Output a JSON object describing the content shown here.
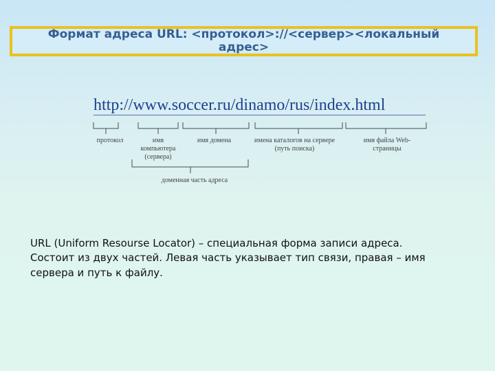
{
  "slide": {
    "title": "Формат адреса URL: <протокол>://<сервер><локальный адрес>",
    "diagram": {
      "url": "http://www.soccer.ru/dinamo/rus/index.html",
      "labels": {
        "protocol": "протокол",
        "computer_name": "имя компьютера (сервера)",
        "domain_name": "имя домена",
        "directory_names": "имена каталогов на сервере (путь поиска)",
        "file_name": "имя файла Web-страницы",
        "domain_part": "доменная часть адреса"
      }
    },
    "body": {
      "line1": "URL (Uniform Resourse Locator) – специальная форма записи адреса.",
      "line2": "Состоит из двух частей. Левая часть указывает тип связи, правая – имя сервера и путь к файлу."
    }
  }
}
